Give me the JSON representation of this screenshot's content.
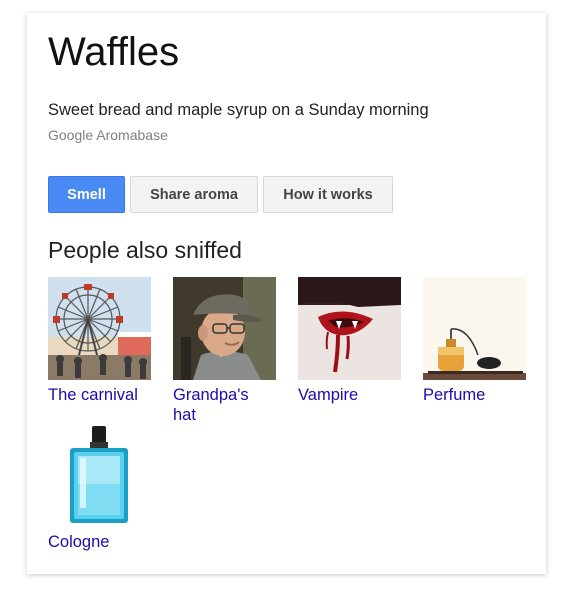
{
  "card": {
    "title": "Waffles",
    "description": "Sweet bread and maple syrup on a Sunday morning",
    "source": "Google Aromabase"
  },
  "actions": {
    "smell_label": "Smell",
    "share_label": "Share aroma",
    "how_label": "How it works"
  },
  "related": {
    "heading": "People also sniffed",
    "items": [
      {
        "label": "The carnival",
        "image": "ferris-wheel"
      },
      {
        "label": "Grandpa's hat",
        "image": "man-in-flat-cap"
      },
      {
        "label": "Vampire",
        "image": "vampire-mouth"
      },
      {
        "label": "Perfume",
        "image": "perfume-atomizer"
      },
      {
        "label": "Cologne",
        "image": "cologne-bottle"
      }
    ]
  },
  "colors": {
    "primary_button": "#4a8af4",
    "link": "#1a0dab",
    "source_text": "#808080"
  }
}
